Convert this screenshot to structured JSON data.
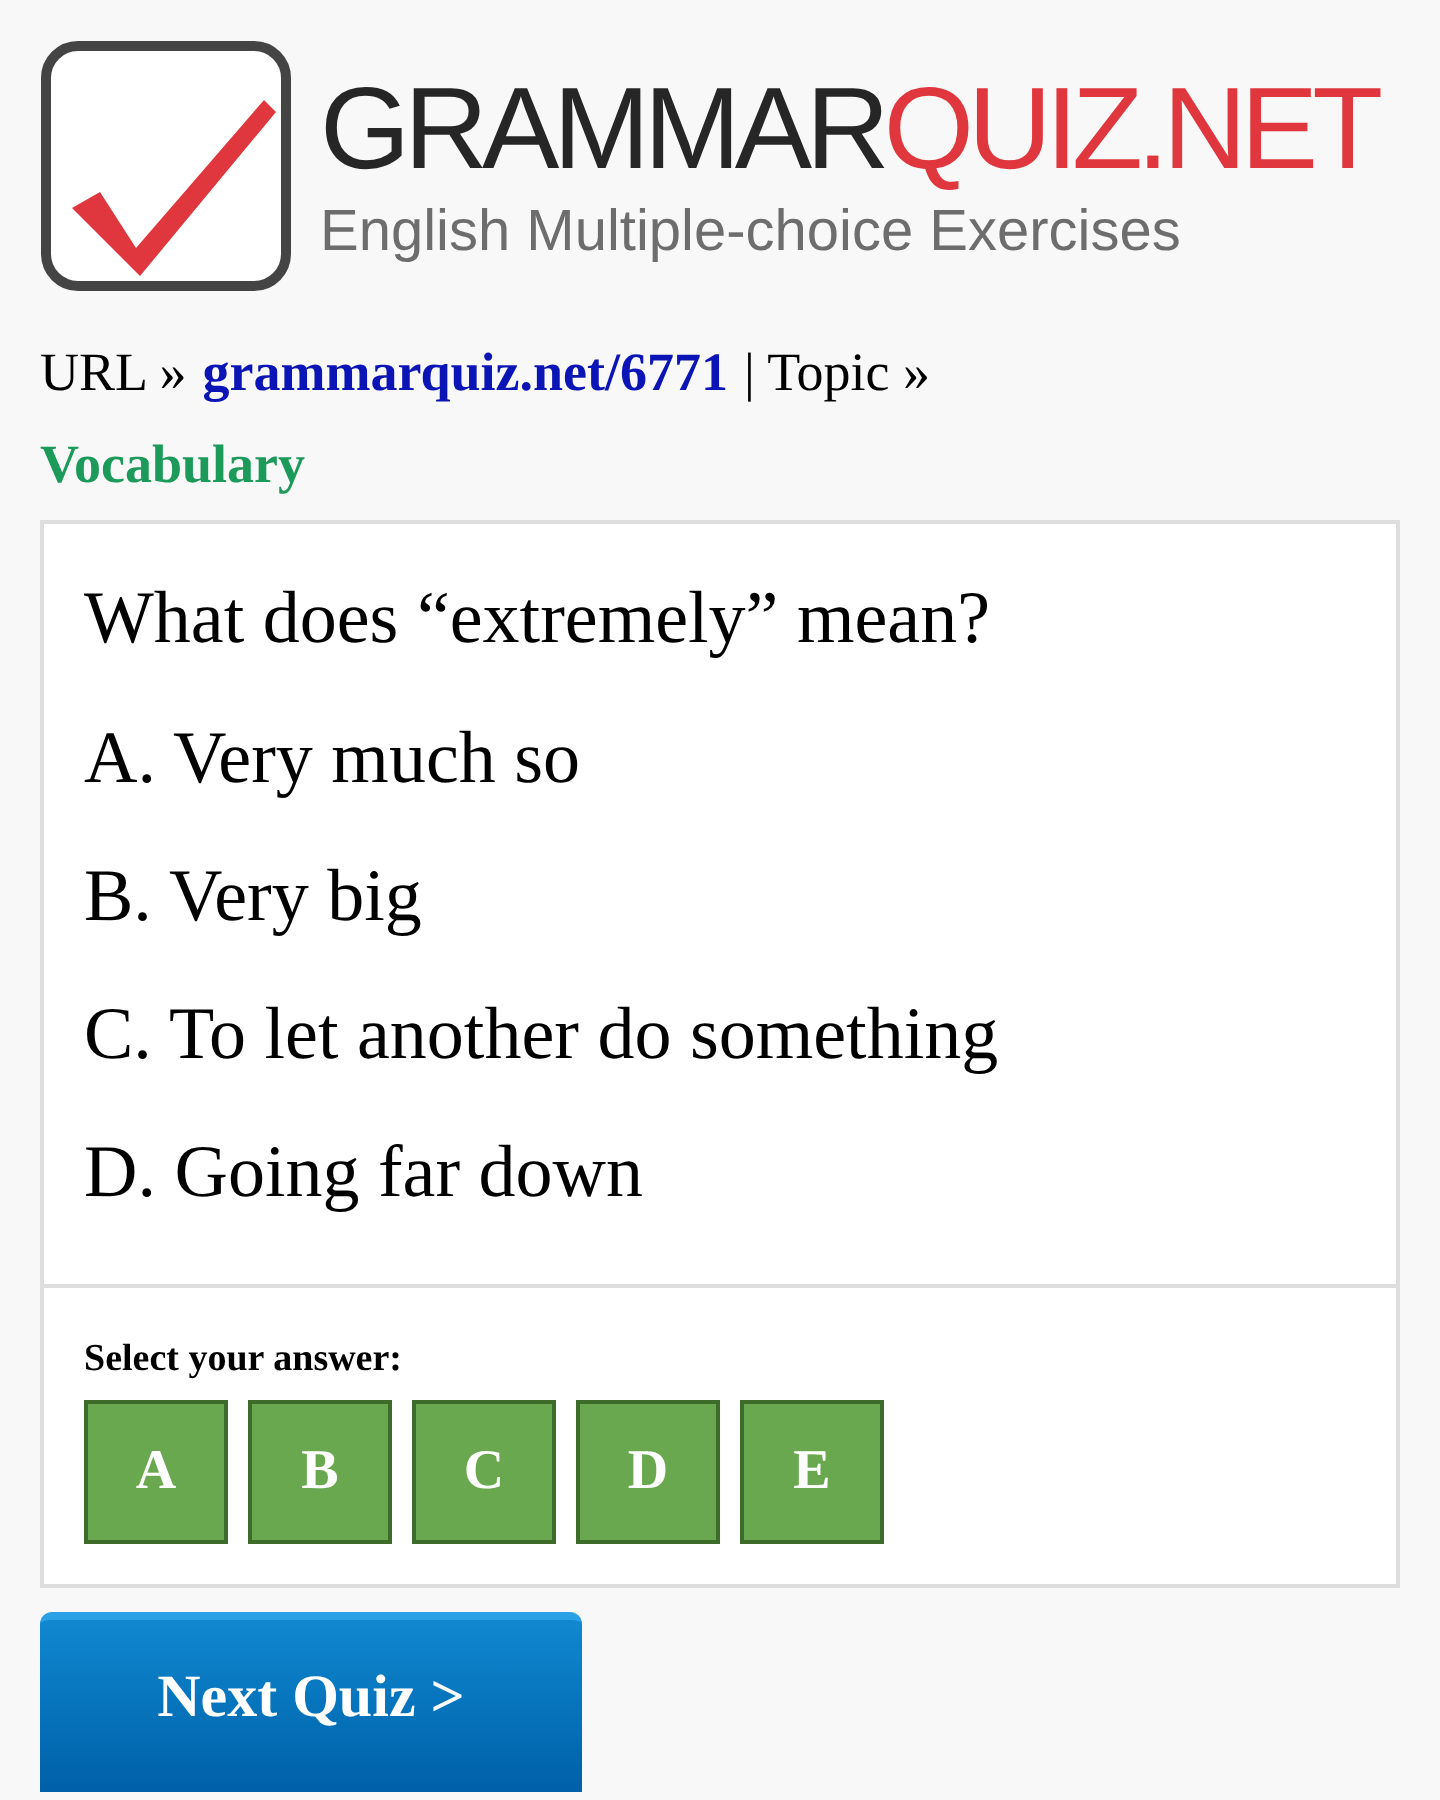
{
  "logo": {
    "name_dark": "GRAMMAR",
    "name_red": "QUIZ.NET",
    "tagline": "English Multiple-choice Exercises"
  },
  "breadcrumb": {
    "url_label": "URL »",
    "url_link": "grammarquiz.net/6771",
    "topic_label": "| Topic »",
    "topic": "Vocabulary"
  },
  "question": "What does “extremely” mean?",
  "options": [
    "A. Very much so",
    "B. Very big",
    "C. To let another do something",
    "D. Going far down"
  ],
  "answer_prompt": "Select your answer:",
  "answer_buttons": [
    "A",
    "B",
    "C",
    "D",
    "E"
  ],
  "next_button": "Next Quiz >"
}
